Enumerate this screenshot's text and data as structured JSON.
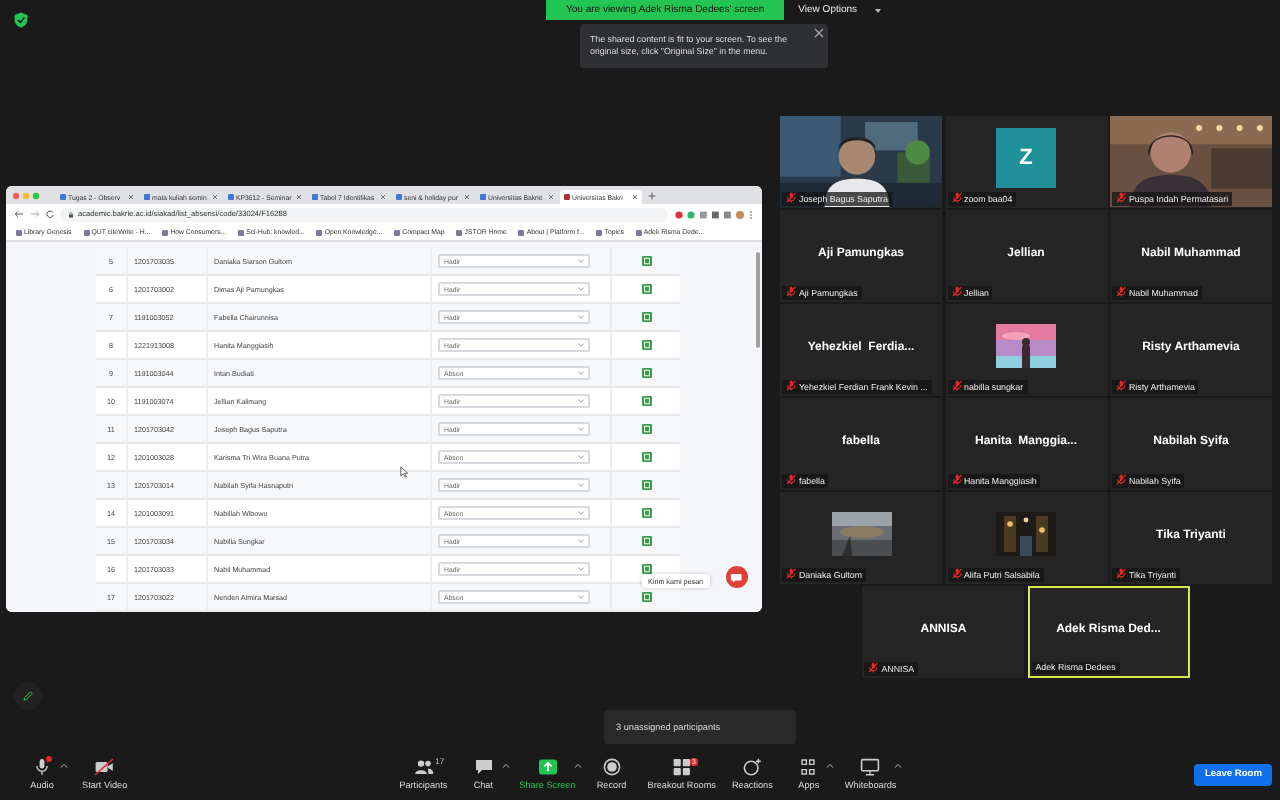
{
  "banner": {
    "text": "You are viewing Adek Risma Dedees' screen"
  },
  "view_options": {
    "label": "View Options"
  },
  "notice": {
    "text": "The shared content is fit to your screen. To see the original size, click \"Original Size\" in the menu."
  },
  "shared_screen": {
    "tabs": [
      {
        "label": "Tugas 2 - Observ",
        "selected": false
      },
      {
        "label": "mata kuliah semin",
        "selected": false
      },
      {
        "label": "KP3612 - Seminar",
        "selected": false
      },
      {
        "label": "Tabel 7 Identifikas",
        "selected": false
      },
      {
        "label": "seni & holiday pur",
        "selected": false
      },
      {
        "label": "Universitas Bakrie",
        "selected": false
      },
      {
        "label": "Universitas Bakri",
        "selected": true
      }
    ],
    "url": "academic.bakrie.ac.id/siakad/list_absensi/code/33024/F16288",
    "bookmarks": [
      "Library Genesis",
      "QUT citeWrite - H...",
      "How Consumers...",
      "Sci-Hub: knowled...",
      "Open Knowledge...",
      "Compact Map",
      "JSTOR Home",
      "About | Platform f...",
      "Topics",
      "Adek Risma Dede..."
    ],
    "rows": [
      {
        "no": "5",
        "nim": "1201703035",
        "name": "Daniaka Siarson Gultom",
        "status": "Hadir"
      },
      {
        "no": "6",
        "nim": "1201703002",
        "name": "Dimas Aji Pamungkas",
        "status": "Hadir"
      },
      {
        "no": "7",
        "nim": "1191003052",
        "name": "Fabella Chairunnisa",
        "status": "Hadir"
      },
      {
        "no": "8",
        "nim": "1221913008",
        "name": "Hanita Manggiasih",
        "status": "Hadir"
      },
      {
        "no": "9",
        "nim": "1191003044",
        "name": "Intan Budiati",
        "status": "Absen"
      },
      {
        "no": "10",
        "nim": "1191003074",
        "name": "Jellian Kalimang",
        "status": "Hadir"
      },
      {
        "no": "11",
        "nim": "1201703042",
        "name": "Joseph Bagus Saputra",
        "status": "Hadir"
      },
      {
        "no": "12",
        "nim": "1201003028",
        "name": "Karisma Tri Wira Buana Putra",
        "status": "Absen"
      },
      {
        "no": "13",
        "nim": "1201703014",
        "name": "Nabilah Syifa Hasnaputri",
        "status": "Hadir"
      },
      {
        "no": "14",
        "nim": "1201003091",
        "name": "Nabillah Wibowo",
        "status": "Absen"
      },
      {
        "no": "15",
        "nim": "1201703034",
        "name": "Nabilla Sungkar",
        "status": "Hadir"
      },
      {
        "no": "16",
        "nim": "1201703033",
        "name": "Nabil Muhammad",
        "status": "Hadir"
      },
      {
        "no": "17",
        "nim": "1201703022",
        "name": "Nenden Almira Marsad",
        "status": "Absen"
      }
    ],
    "chat_prompt": "Kirim kami pesan"
  },
  "participants": [
    {
      "kind": "video",
      "label": "Joseph Bagus Saputra",
      "muted": true,
      "active": false
    },
    {
      "kind": "avatar",
      "letter": "Z",
      "label": "zoom baa04",
      "muted": true,
      "active": false
    },
    {
      "kind": "video",
      "label": "Puspa Indah Permatasari",
      "muted": true,
      "active": false
    },
    {
      "kind": "name",
      "display_name": "Aji Pamungkas",
      "label": "Aji Pamungkas",
      "muted": true,
      "active": false
    },
    {
      "kind": "name",
      "display_name": "Jellian",
      "label": "Jellian",
      "muted": true,
      "active": false
    },
    {
      "kind": "name",
      "display_name": "Nabil Muhammad",
      "label": "Nabil Muhammad",
      "muted": true,
      "active": false
    },
    {
      "kind": "name",
      "display_name": "Yehezkiel  Ferdia...",
      "label": "Yehezkiel Ferdian Frank Kevin ...",
      "muted": true,
      "active": false
    },
    {
      "label": "nabilla sungkar",
      "muted": true,
      "active": false
    },
    {
      "kind": "name",
      "display_name": "Risty Arthamevia",
      "label": "Risty Arthamevia",
      "muted": true,
      "active": false
    },
    {
      "kind": "name",
      "display_name": "fabella",
      "label": "fabella",
      "muted": true,
      "active": false
    },
    {
      "kind": "name",
      "display_name": "Hanita  Manggia...",
      "label": "Hanita Manggiasih",
      "muted": true,
      "active": false
    },
    {
      "kind": "name",
      "display_name": "Nabilah Syifa",
      "label": "Nabilah Syifa",
      "muted": true,
      "active": false
    },
    {
      "label": "Daniaka Gultom",
      "muted": true,
      "active": false
    },
    {
      "label": "Alifa Putri Salsabila",
      "muted": true,
      "active": false
    },
    {
      "kind": "name",
      "display_name": "Tika Triyanti",
      "label": "Tika Triyanti",
      "muted": true,
      "active": false
    },
    {
      "kind": "name",
      "display_name": "ANNISA",
      "label": "ANNISA",
      "muted": true,
      "active": false
    },
    {
      "kind": "name",
      "display_name": "Adek Risma Ded...",
      "label": "Adek Risma Dedees",
      "muted": false,
      "active": true
    }
  ],
  "unassigned_tooltip": "3 unassigned participants",
  "toolbar": [
    {
      "kind": "audio",
      "label": "Audio",
      "alert": true,
      "caret": true
    },
    {
      "kind": "video",
      "label": "Start Video",
      "caret": false
    },
    {
      "kind": "participants",
      "label": "Participants",
      "count": "17",
      "caret": false
    },
    {
      "kind": "chat",
      "label": "Chat",
      "caret": true
    },
    {
      "kind": "share",
      "label": "Share Screen",
      "caret": true
    },
    {
      "kind": "record",
      "label": "Record",
      "caret": false
    },
    {
      "kind": "breakout",
      "label": "Breakout Rooms",
      "badge": "3",
      "caret": false
    },
    {
      "kind": "reactions",
      "label": "Reactions",
      "caret": false
    },
    {
      "kind": "apps",
      "label": "Apps",
      "caret": true
    },
    {
      "kind": "whiteboards",
      "label": "Whiteboards",
      "caret": true
    }
  ],
  "leave_button": "Leave Room"
}
